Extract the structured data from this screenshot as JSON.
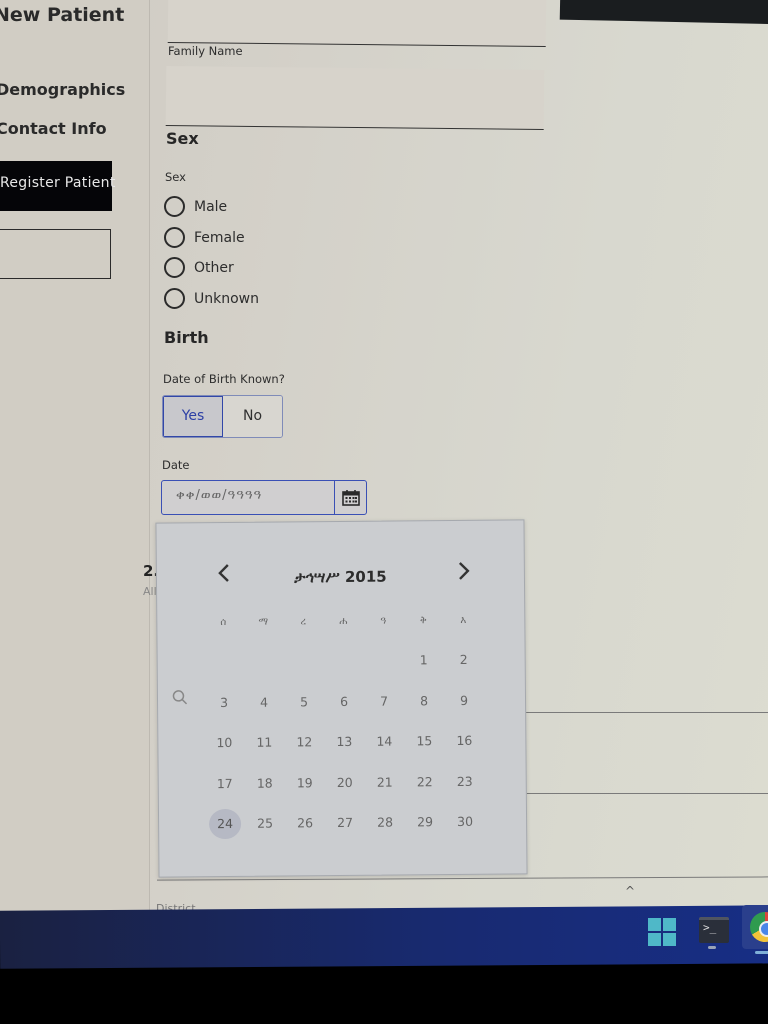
{
  "sidebar": {
    "title": "New Patient",
    "items": [
      {
        "label": "Demographics"
      },
      {
        "label": "Contact Info"
      }
    ],
    "primary_button": "Register Patient",
    "secondary_button": ""
  },
  "form": {
    "given_name_value": "",
    "family_name_label": "Family Name",
    "family_name_value": "",
    "sex_section": "Sex",
    "sex_label": "Sex",
    "sex_options": [
      "Male",
      "Female",
      "Other",
      "Unknown"
    ],
    "birth_section": "Birth",
    "dob_known_label": "Date of Birth Known?",
    "dob_known_options": {
      "yes": "Yes",
      "no": "No"
    },
    "dob_known_selected": "Yes",
    "date_label": "Date",
    "date_placeholder": "ቀቀ/ወወ/ዓዓዓዓ",
    "date_icon": "calendar-icon",
    "next_section_number": "2.",
    "next_section_hint": "All",
    "district_label": "District"
  },
  "calendar": {
    "month_year": "ታኅሣሥ 2015",
    "prev_icon": "chevron-left-icon",
    "next_icon": "chevron-right-icon",
    "weekdays": [
      "ሰ",
      "ማ",
      "ረ",
      "ሐ",
      "ዓ",
      "ቅ",
      "እ"
    ],
    "leading_blanks": 5,
    "days": [
      "1",
      "2",
      "3",
      "4",
      "5",
      "6",
      "7",
      "8",
      "9",
      "10",
      "11",
      "12",
      "13",
      "14",
      "15",
      "16",
      "17",
      "18",
      "19",
      "20",
      "21",
      "22",
      "23",
      "24",
      "25",
      "26",
      "27",
      "28",
      "29",
      "30"
    ],
    "today": "24"
  },
  "taskbar": {
    "items": [
      "start-icon",
      "terminal-icon",
      "chrome-icon"
    ],
    "terminal_glyph": ">_"
  }
}
